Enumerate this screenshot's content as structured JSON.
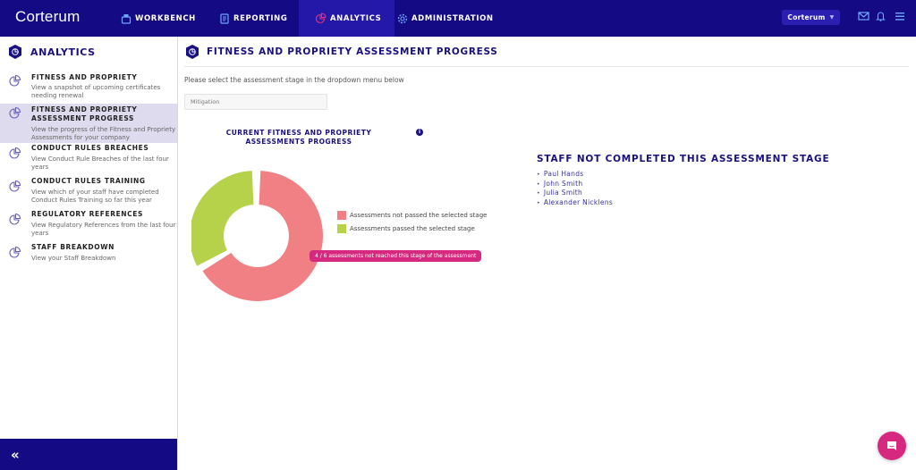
{
  "topbar": {
    "brand": "Corterum",
    "nav": [
      {
        "label": "WORKBENCH",
        "icon": "workbench-icon",
        "active": false
      },
      {
        "label": "REPORTING",
        "icon": "document-icon",
        "active": false
      },
      {
        "label": "ANALYTICS",
        "icon": "pie-chart-icon",
        "active": true
      },
      {
        "label": "ADMINISTRATION",
        "icon": "gear-icon",
        "active": false
      }
    ],
    "org_selector": "Corterum",
    "icons": [
      "mail-icon",
      "bell-icon",
      "hamburger-menu-icon"
    ]
  },
  "sidebar": {
    "title": "ANALYTICS",
    "items": [
      {
        "title": "FITNESS AND PROPRIETY",
        "desc": "View a snapshot of upcoming certificates needing renewal",
        "active": false
      },
      {
        "title": "FITNESS AND PROPRIETY ASSESSMENT PROGRESS",
        "desc": "View the progress of the Fitness and Propriety Assessments for your company",
        "active": true
      },
      {
        "title": "CONDUCT RULES BREACHES",
        "desc": "View Conduct Rule Breaches of the last four years",
        "active": false
      },
      {
        "title": "CONDUCT RULES TRAINING",
        "desc": "View which of your staff have completed Conduct Rules Training so far this year",
        "active": false
      },
      {
        "title": "REGULATORY REFERENCES",
        "desc": "View Regulatory References from the last four years",
        "active": false
      },
      {
        "title": "STAFF BREAKDOWN",
        "desc": "View your Staff Breakdown",
        "active": false
      }
    ],
    "collapse_label": "«"
  },
  "main": {
    "title": "FITNESS AND PROPRIETY ASSESSMENT PROGRESS",
    "instruction": "Please select the assessment stage in the dropdown menu below",
    "stage_select": {
      "value": "Mitigation"
    },
    "chart_title": "CURRENT FITNESS AND PROPRIETY ASSESSMENTS PROGRESS",
    "info_icon": "i",
    "tooltip": "4 / 6 assessments not reached this stage of the assessment",
    "staff_title": "STAFF NOT COMPLETED THIS ASSESSMENT STAGE",
    "staff": [
      "Paul Hands",
      "John Smith",
      "Julia Smith",
      "Alexander Nicklens"
    ]
  },
  "colors": {
    "brand": "#140b84",
    "accent": "#d6287f",
    "not_passed": "#f08084",
    "passed": "#b5d24a"
  },
  "chart_data": {
    "type": "pie",
    "variant": "donut",
    "title": "CURRENT FITNESS AND PROPRIETY ASSESSMENTS PROGRESS",
    "categories": [
      "Assessments not passed the selected stage",
      "Assessments passed the selected stage"
    ],
    "values": [
      4,
      2
    ],
    "total": 6,
    "colors": [
      "#f08084",
      "#b5d24a"
    ],
    "legend_position": "right",
    "selected_slice": 0,
    "annotation": "4 / 6 assessments not reached this stage of the assessment"
  }
}
